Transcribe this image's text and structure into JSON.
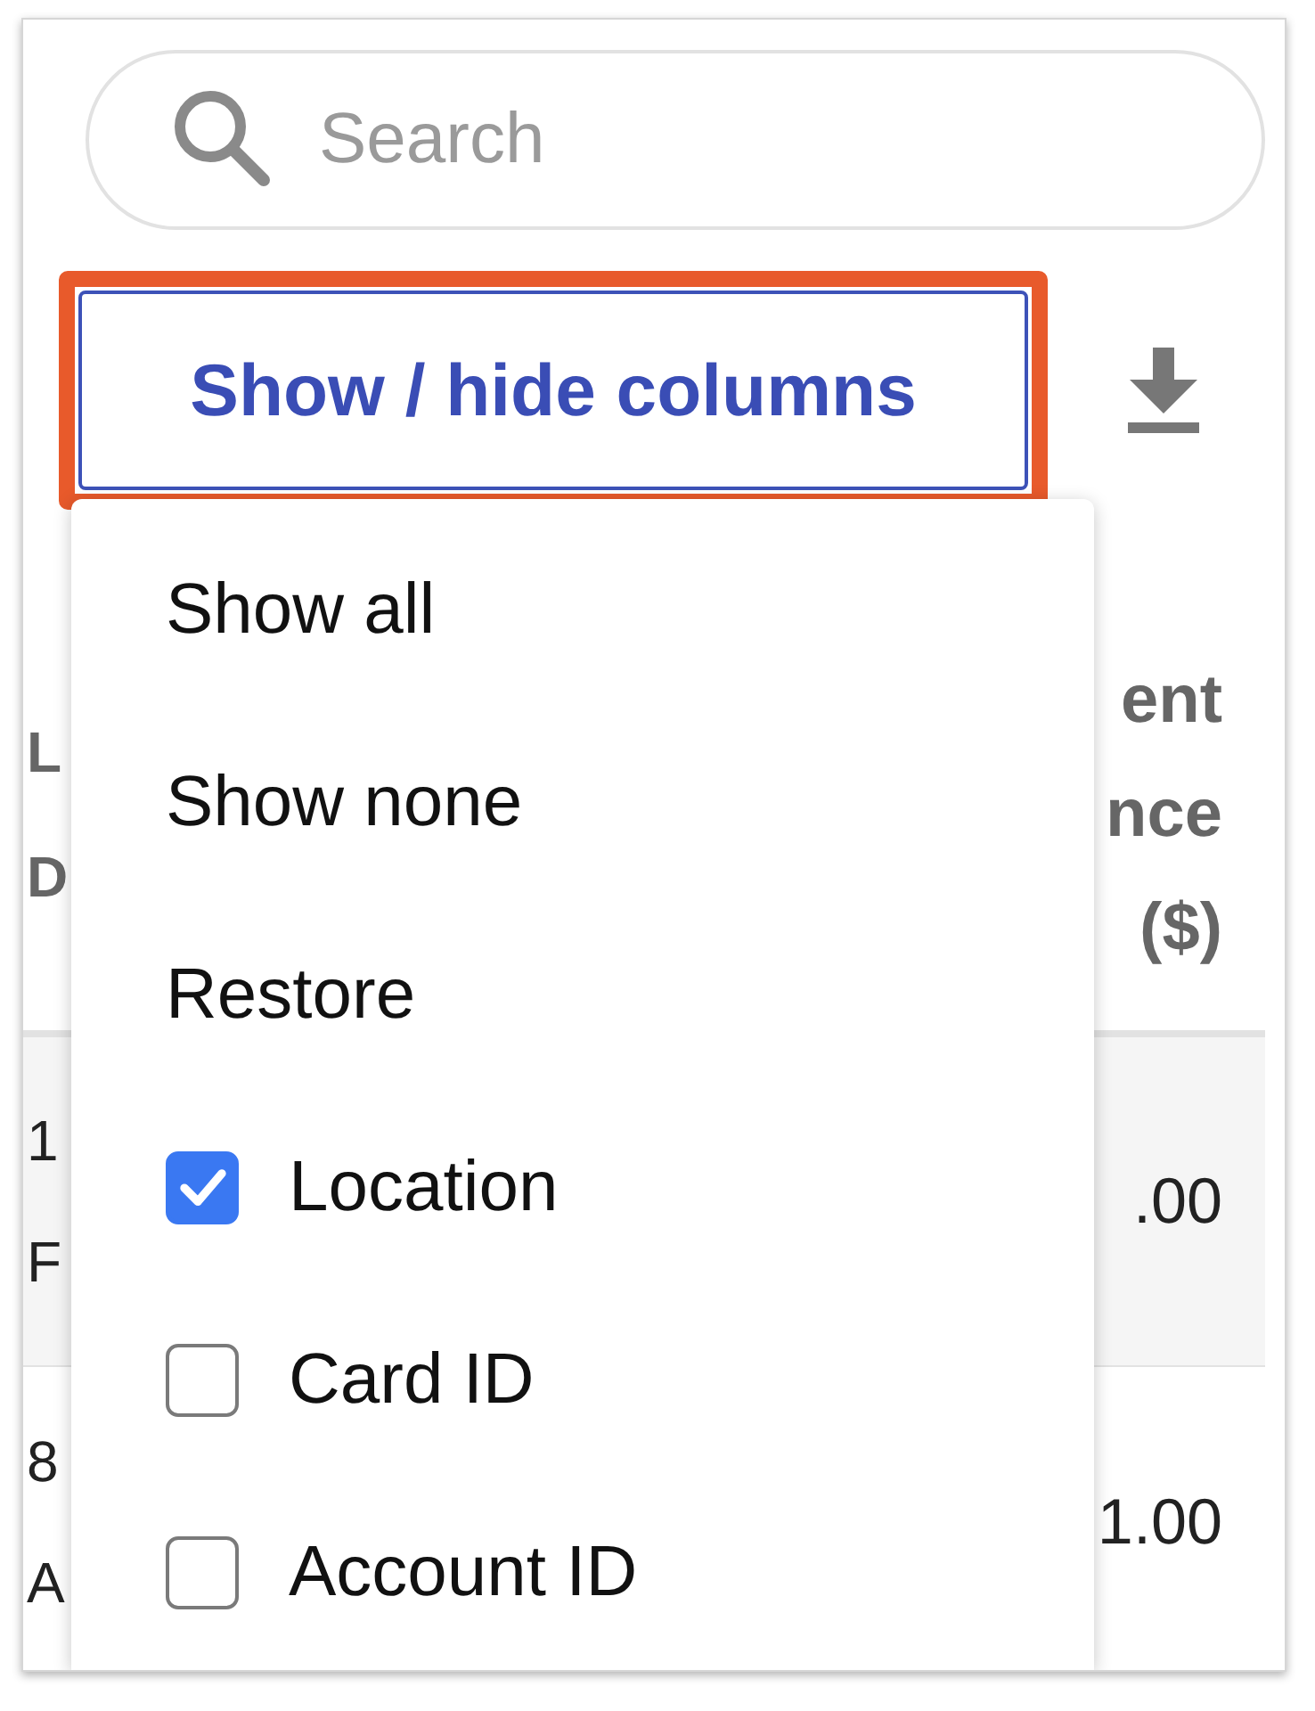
{
  "search": {
    "placeholder": "Search"
  },
  "toolbar": {
    "columns_button": {
      "label": "Show / hide columns",
      "highlighted": true
    }
  },
  "table": {
    "columns": [
      {
        "lines": [
          "L",
          "D"
        ]
      },
      {
        "lines": [
          "ent",
          "nce",
          "($)"
        ]
      }
    ],
    "rows": [
      {
        "cells": [
          {
            "lines": [
              "1",
              "F"
            ]
          },
          {
            "lines": [
              ".00"
            ]
          }
        ]
      },
      {
        "cells": [
          {
            "lines": [
              "8",
              "A"
            ]
          },
          {
            "lines": [
              "1.00"
            ]
          }
        ]
      }
    ]
  },
  "column_menu": {
    "items": [
      {
        "kind": "action",
        "label": "Show all"
      },
      {
        "kind": "action",
        "label": "Show none"
      },
      {
        "kind": "action",
        "label": "Restore"
      },
      {
        "kind": "column",
        "label": "Location",
        "checked": true
      },
      {
        "kind": "column",
        "label": "Card ID",
        "checked": false
      },
      {
        "kind": "column",
        "label": "Account ID",
        "checked": false
      }
    ]
  }
}
